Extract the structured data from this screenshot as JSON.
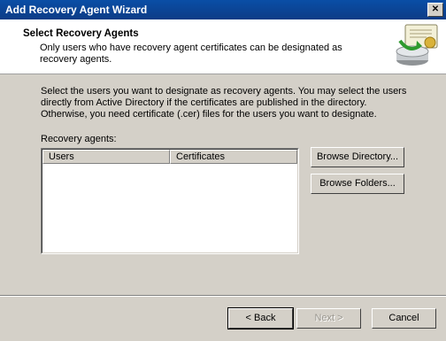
{
  "window": {
    "title": "Add Recovery Agent Wizard"
  },
  "header": {
    "title": "Select Recovery Agents",
    "subtitle": "Only users who have recovery agent certificates can be designated as recovery agents."
  },
  "intro": "Select the users you want to designate as recovery agents. You may select the users directly from Active Directory if the certificates are published in the directory. Otherwise, you need certificate (.cer) files for the users you want to designate.",
  "recovery_agents": {
    "label": "Recovery agents:",
    "columns": [
      "Users",
      "Certificates"
    ]
  },
  "buttons": {
    "browse_directory": "Browse Directory...",
    "browse_folders": "Browse Folders...",
    "back": "< Back",
    "next": "Next >",
    "cancel": "Cancel"
  },
  "icons": {
    "wizard": "certificate-disk-icon",
    "close": "close-icon"
  }
}
